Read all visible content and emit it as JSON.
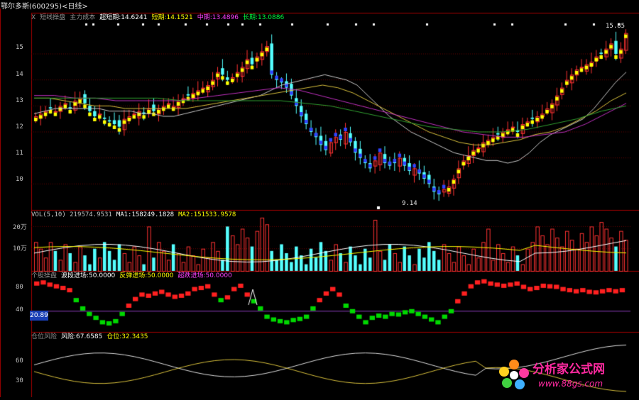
{
  "title": "鄂尔多斯(600295)<日线>",
  "colors": {
    "bg": "#000000",
    "frame": "#a00000",
    "up": "#ff3232",
    "down": "#54ffff",
    "blue": "#3044ff",
    "yellow": "#ffff00",
    "ma_white": "#c8c8c8",
    "ma_yellow": "#d8c03c",
    "ma_magenta": "#c030c0",
    "ma_green": "#30a030",
    "osc_green": "#00d800",
    "osc_red": "#ff2020",
    "line40": "#9040c0"
  },
  "main_header": {
    "items": [
      {
        "text": "X",
        "color": "#909090"
      },
      {
        "text": "短线操盘",
        "color": "#909090"
      },
      {
        "text": "主力成本",
        "color": "#909090"
      },
      {
        "text": "超短期:14.6241",
        "color": "#ffffff"
      },
      {
        "text": "短期:14.1521",
        "color": "#ffff00"
      },
      {
        "text": "中期:13.4896",
        "color": "#ff40ff"
      },
      {
        "text": "长期:13.0886",
        "color": "#00ff40"
      }
    ]
  },
  "price_axis": [
    "15",
    "14",
    "13",
    "12",
    "11",
    "10"
  ],
  "max_label": "15.85",
  "min_label": "9.14",
  "vol_header": {
    "items": [
      {
        "text": "VOL(5,10) 219574.9531",
        "color": "#c0c0c0"
      },
      {
        "text": "MA1:158249.1828",
        "color": "#ffffff"
      },
      {
        "text": "MA2:151533.9578",
        "color": "#ffff00"
      }
    ]
  },
  "vol_axis": [
    "20万",
    "10万"
  ],
  "osc_header": {
    "items": [
      {
        "text": "个股操盘",
        "color": "#909090"
      },
      {
        "text": "波段进场:50.0000",
        "color": "#ffffff"
      },
      {
        "text": "反弹进场:50.0000",
        "color": "#ffff00"
      },
      {
        "text": "超跌进场:50.0000",
        "color": "#ff40ff"
      }
    ]
  },
  "osc_axis": [
    "80",
    "40"
  ],
  "osc_tag": "20.89",
  "risk_header": {
    "items": [
      {
        "text": "仓位风险",
        "color": "#909090"
      },
      {
        "text": "风险:67.6585",
        "color": "#ffffff"
      },
      {
        "text": "仓位:32.3435",
        "color": "#ffff00"
      }
    ]
  },
  "risk_axis": [
    "60",
    "30"
  ],
  "watermark": {
    "name": "分析家公式网",
    "url": "www.88gs.com"
  },
  "chart_data": {
    "type": "candlestick",
    "price_range": [
      9.0,
      16.2
    ],
    "close": [
      12.6,
      12.7,
      12.8,
      12.9,
      12.8,
      13.0,
      13.1,
      12.9,
      13.2,
      13.3,
      13.1,
      12.8,
      12.6,
      12.7,
      12.5,
      12.4,
      12.3,
      12.2,
      12.5,
      12.6,
      12.7,
      12.8,
      12.7,
      12.9,
      12.8,
      12.9,
      13.0,
      13.1,
      13.0,
      13.2,
      13.3,
      13.4,
      13.5,
      13.6,
      13.7,
      13.8,
      14.0,
      14.3,
      14.2,
      14.0,
      14.1,
      14.3,
      14.5,
      14.8,
      14.6,
      14.9,
      15.1,
      15.3,
      14.2,
      14.0,
      13.9,
      13.7,
      13.4,
      13.0,
      12.6,
      12.3,
      12.0,
      11.8,
      11.5,
      11.3,
      11.6,
      11.8,
      11.7,
      12.0,
      11.6,
      11.2,
      11.0,
      10.8,
      10.6,
      10.9,
      11.2,
      10.8,
      10.7,
      10.8,
      11.0,
      10.7,
      10.5,
      10.6,
      10.4,
      10.2,
      10.0,
      9.7,
      9.6,
      9.8,
      9.9,
      10.2,
      10.6,
      10.9,
      11.1,
      11.3,
      11.4,
      11.6,
      11.7,
      11.8,
      11.9,
      12.0,
      12.1,
      12.2,
      12.0,
      12.3,
      12.4,
      12.5,
      12.6,
      12.7,
      12.9,
      13.1,
      13.4,
      13.7,
      14.0,
      14.2,
      14.4,
      14.5,
      14.6,
      14.7,
      14.9,
      15.0,
      15.2,
      15.4,
      15.0,
      15.2,
      15.8
    ],
    "ma_short": [
      12.7,
      12.8,
      12.9,
      12.9,
      12.9,
      12.9,
      12.9,
      12.8,
      12.8,
      12.8,
      12.7,
      12.7,
      12.6,
      12.6,
      12.7,
      12.8,
      12.9,
      13.0,
      13.1,
      13.2,
      13.3,
      13.4,
      13.6,
      13.8,
      13.9,
      14.0,
      14.1,
      14.2,
      14.1,
      14.0,
      13.8,
      13.4,
      13.0,
      12.6,
      12.3,
      12.0,
      11.8,
      11.6,
      11.4,
      11.2,
      11.1,
      11.0,
      10.9,
      10.9,
      10.8,
      10.9,
      11.2,
      11.6,
      11.9,
      12.1,
      12.3,
      12.5,
      12.9,
      13.4,
      13.9,
      14.3
    ],
    "ma_mid": [
      13.3,
      13.3,
      13.2,
      13.1,
      13.0,
      13.0,
      12.9,
      12.9,
      12.9,
      12.9,
      12.9,
      13.0,
      13.1,
      13.2,
      13.3,
      13.4,
      13.5,
      13.6,
      13.7,
      13.8,
      13.7,
      13.5,
      13.2,
      12.9,
      12.6,
      12.3,
      12.0,
      11.8,
      11.6,
      11.5,
      11.5,
      11.6,
      11.7,
      11.9,
      12.0,
      12.2,
      12.5,
      12.8,
      13.2,
      13.5
    ],
    "ma_long": [
      13.4,
      13.4,
      13.3,
      13.3,
      13.2,
      13.2,
      13.2,
      13.2,
      13.3,
      13.4,
      13.5,
      13.6,
      13.7,
      13.6,
      13.4,
      13.2,
      13.0,
      12.8,
      12.6,
      12.4,
      12.2,
      12.0,
      11.9,
      11.8,
      11.8,
      11.9,
      12.0,
      12.3,
      12.7,
      13.1
    ],
    "ma_longest": [
      13.3,
      13.3,
      13.3,
      13.3,
      13.3,
      13.3,
      13.2,
      13.2,
      13.2,
      13.2,
      13.2,
      13.1,
      13.0,
      12.8,
      12.6,
      12.4,
      12.2,
      12.1,
      12.0,
      12.0,
      12.1,
      12.3,
      12.5,
      12.8,
      13.0
    ],
    "volume_max_wan": 23,
    "osc_range": [
      0,
      100
    ],
    "osc": [
      90,
      92,
      88,
      85,
      82,
      78,
      60,
      45,
      35,
      28,
      20,
      18,
      22,
      35,
      50,
      62,
      70,
      68,
      72,
      75,
      70,
      66,
      68,
      72,
      80,
      82,
      85,
      70,
      60,
      65,
      80,
      86,
      70,
      58,
      45,
      30,
      25,
      22,
      20,
      24,
      26,
      30,
      45,
      60,
      72,
      80,
      70,
      50,
      40,
      30,
      20,
      28,
      32,
      30,
      35,
      34,
      38,
      40,
      35,
      30,
      25,
      20,
      30,
      40,
      58,
      72,
      85,
      92,
      94,
      90,
      88,
      86,
      88,
      90,
      84,
      80,
      82,
      86,
      85,
      84,
      80,
      78,
      76,
      78,
      75,
      74,
      76,
      78,
      76,
      78
    ]
  }
}
